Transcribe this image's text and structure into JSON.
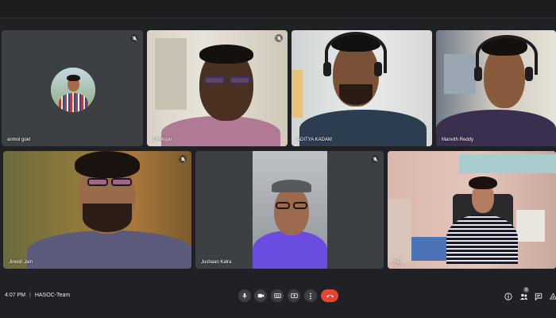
{
  "meeting": {
    "time": "4:07 PM",
    "separator": "|",
    "name": "HASOC-Team",
    "participant_count": "8"
  },
  "participants": [
    {
      "name": "anmol goel",
      "muted": true,
      "video": false
    },
    {
      "name": "T.H Arjun",
      "muted": true,
      "video": true
    },
    {
      "name": "ADITYA KADAM",
      "muted": false,
      "video": true
    },
    {
      "name": "Manvith Reddy",
      "muted": false,
      "video": true
    },
    {
      "name": "Jinesh Jain",
      "muted": true,
      "video": true
    },
    {
      "name": "Jushaan Kalra",
      "muted": true,
      "video": true
    },
    {
      "name": "You",
      "muted": false,
      "video": true,
      "active_speaker": true
    }
  ],
  "controls": [
    "microphone-icon",
    "camera-icon",
    "captions-icon",
    "present-icon",
    "more-options-icon",
    "end-call-icon"
  ],
  "right_controls": [
    "info-icon",
    "people-icon",
    "chat-icon",
    "activities-icon"
  ],
  "colors": {
    "background": "#202124",
    "tile": "#3c4043",
    "end_call": "#ea4335",
    "active_outline": "#8ab4f8"
  }
}
